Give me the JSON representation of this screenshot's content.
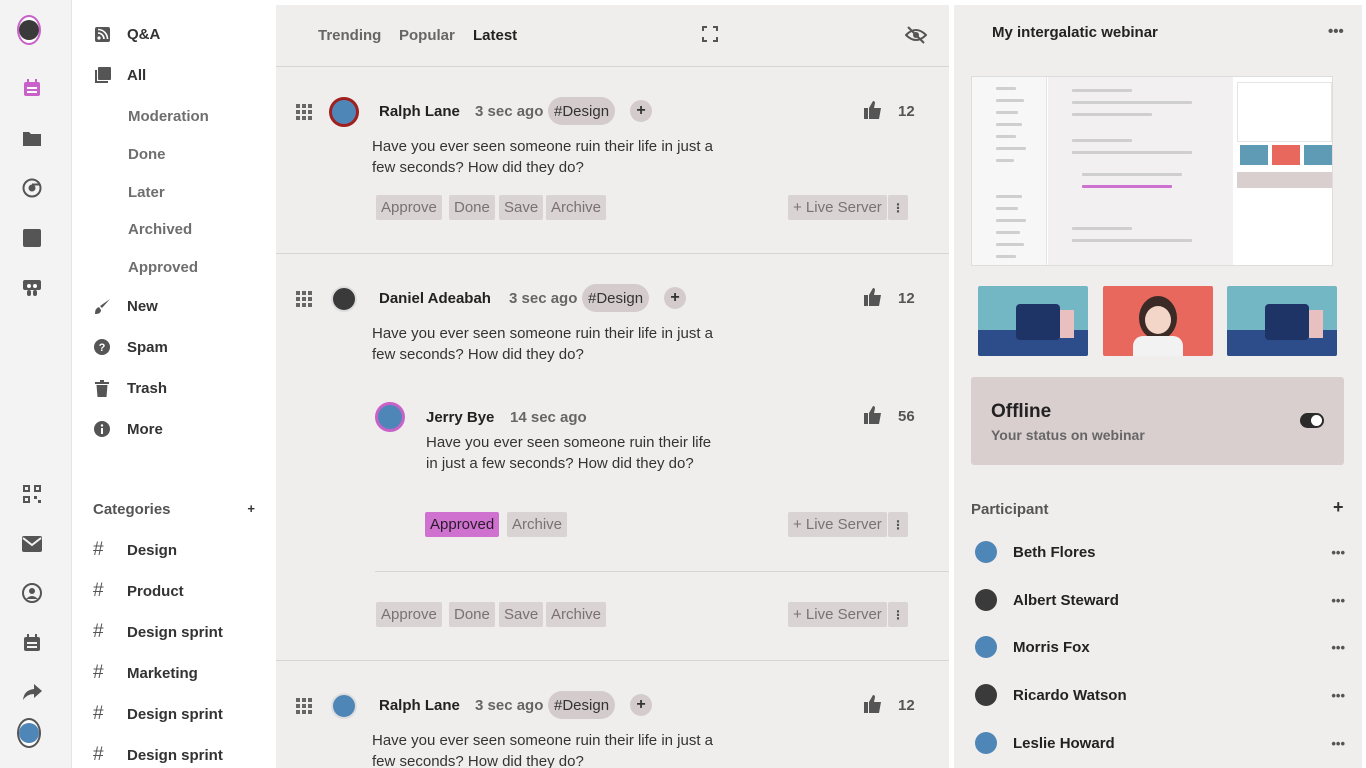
{
  "nav": {
    "qa": "Q&A",
    "all": "All",
    "subs": [
      "Moderation",
      "Done",
      "Later",
      "Archived",
      "Approved"
    ],
    "new": "New",
    "spam": "Spam",
    "trash": "Trash",
    "more": "More",
    "categories_title": "Categories",
    "categories_add": "+",
    "categories": [
      "Design",
      "Product",
      "Design sprint",
      "Marketing",
      "Design sprint",
      "Design sprint"
    ],
    "hash": "#"
  },
  "feed": {
    "tabs": [
      "Trending",
      "Popular",
      "Latest"
    ],
    "active_tab": "Latest",
    "posts": [
      {
        "author": "Ralph Lane",
        "time": "3 sec ago",
        "tag": "#Design",
        "likes": "12",
        "text": "Have you ever seen someone ruin their life in just a few seconds? How did they do?",
        "actions": [
          "Approve",
          "Done",
          "Save",
          "Archive"
        ],
        "live": "+ Live Server"
      },
      {
        "author": "Daniel Adeabah",
        "time": "3 sec ago",
        "tag": "#Design",
        "likes": "12",
        "text": "Have you ever seen someone ruin their life in just a few seconds? How did they do?",
        "reply": {
          "author": "Jerry Bye",
          "time": "14 sec ago",
          "likes": "56",
          "text": "Have you ever seen someone ruin their life in just a few seconds? How did they do?",
          "actions": [
            "Approved",
            "Archive"
          ],
          "live": "+ Live Server"
        },
        "actions": [
          "Approve",
          "Done",
          "Save",
          "Archive"
        ],
        "live": "+ Live Server"
      },
      {
        "author": "Ralph Lane",
        "time": "3 sec ago",
        "tag": "#Design",
        "likes": "12",
        "text": "Have you ever seen someone ruin their life in just a few seconds? How did they do?"
      }
    ],
    "plus": "+",
    "kebab": "⋮"
  },
  "right": {
    "title": "My intergalatic webinar",
    "dots": "•••",
    "status_title": "Offline",
    "status_sub": "Your status on webinar",
    "participants_title": "Participant",
    "participants_add": "+",
    "participants": [
      "Beth Flores",
      "Albert Steward",
      "Morris Fox",
      "Ricardo Watson",
      "Leslie Howard"
    ],
    "more": "•••"
  },
  "colors": {
    "accent": "#cf72cf",
    "panel": "#f0eeed",
    "pill": "#d4cccc",
    "status_card": "#d9cfcf"
  }
}
